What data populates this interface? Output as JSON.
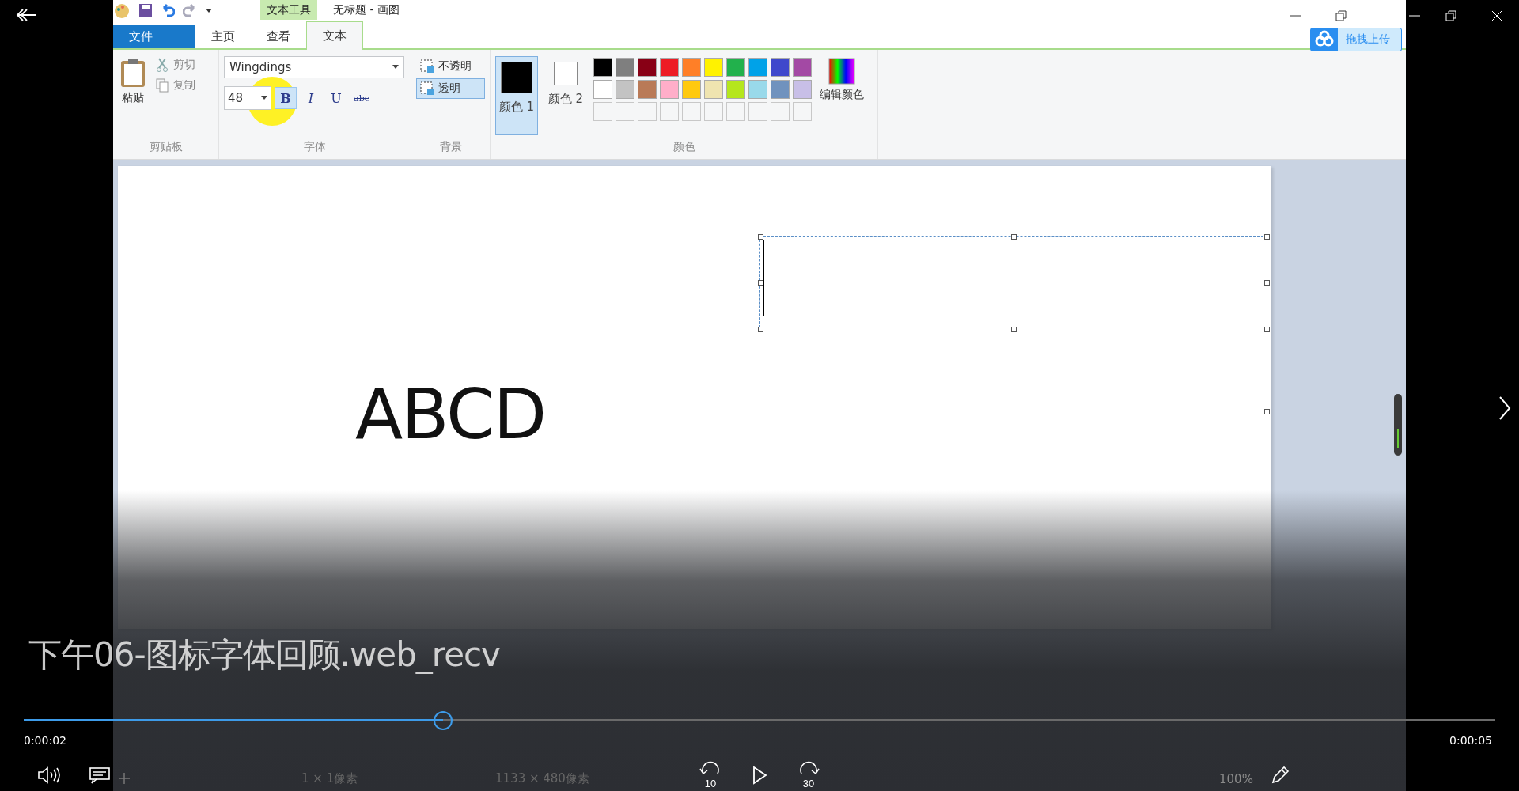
{
  "paint": {
    "context_tab": "文本工具",
    "window_title": "无标题 - 画图",
    "tabs": [
      {
        "label": "文件",
        "kind": "file",
        "selected": false
      },
      {
        "label": "主页",
        "kind": "tab",
        "selected": false
      },
      {
        "label": "查看",
        "kind": "tab",
        "selected": false
      },
      {
        "label": "文本",
        "kind": "tab",
        "selected": true
      }
    ],
    "upload_button": "拖拽上传",
    "clipboard": {
      "paste": "粘贴",
      "cut": "剪切",
      "copy": "复制",
      "group": "剪贴板"
    },
    "font": {
      "family": "Wingdings",
      "size": "48",
      "group": "字体",
      "styles": [
        {
          "label": "B",
          "kind": "bold",
          "selected": true
        },
        {
          "label": "I",
          "kind": "italic",
          "selected": false
        },
        {
          "label": "U",
          "kind": "underline",
          "selected": false
        },
        {
          "label": "abc",
          "kind": "strike",
          "selected": false
        }
      ]
    },
    "background": {
      "group": "背景",
      "options": [
        {
          "label": "不透明",
          "selected": false
        },
        {
          "label": "透明",
          "selected": true
        }
      ]
    },
    "colors": {
      "group": "颜色",
      "edit": "编辑颜色",
      "slots": [
        {
          "label": "颜色 1",
          "color": "#000000",
          "selected": true
        },
        {
          "label": "颜色 2",
          "color": "#ffffff",
          "selected": false
        }
      ],
      "palette": [
        {
          "color": "#000000"
        },
        {
          "color": "#7f7f7f"
        },
        {
          "color": "#880015"
        },
        {
          "color": "#ed1c24"
        },
        {
          "color": "#ff7f27"
        },
        {
          "color": "#fff200"
        },
        {
          "color": "#22b14c"
        },
        {
          "color": "#00a2e8"
        },
        {
          "color": "#3f48cc"
        },
        {
          "color": "#a349a4"
        },
        {
          "color": "#ffffff"
        },
        {
          "color": "#c3c3c3"
        },
        {
          "color": "#b97a57"
        },
        {
          "color": "#ffaec9"
        },
        {
          "color": "#ffc90e"
        },
        {
          "color": "#efe4b0"
        },
        {
          "color": "#b5e61d"
        },
        {
          "color": "#99d9ea"
        },
        {
          "color": "#7092be"
        },
        {
          "color": "#c8bfe7"
        }
      ]
    },
    "canvas": {
      "text": "ABCD"
    },
    "status": [
      "1 × 1像素",
      "1133 × 480像素",
      "100%"
    ]
  },
  "player": {
    "title": "下午06-图标字体回顾.web_recv",
    "progress": {
      "level": 0.285
    },
    "elapsed": "0:00:02",
    "total": "0:00:05",
    "skip_back": "10",
    "skip_forward": "30"
  }
}
